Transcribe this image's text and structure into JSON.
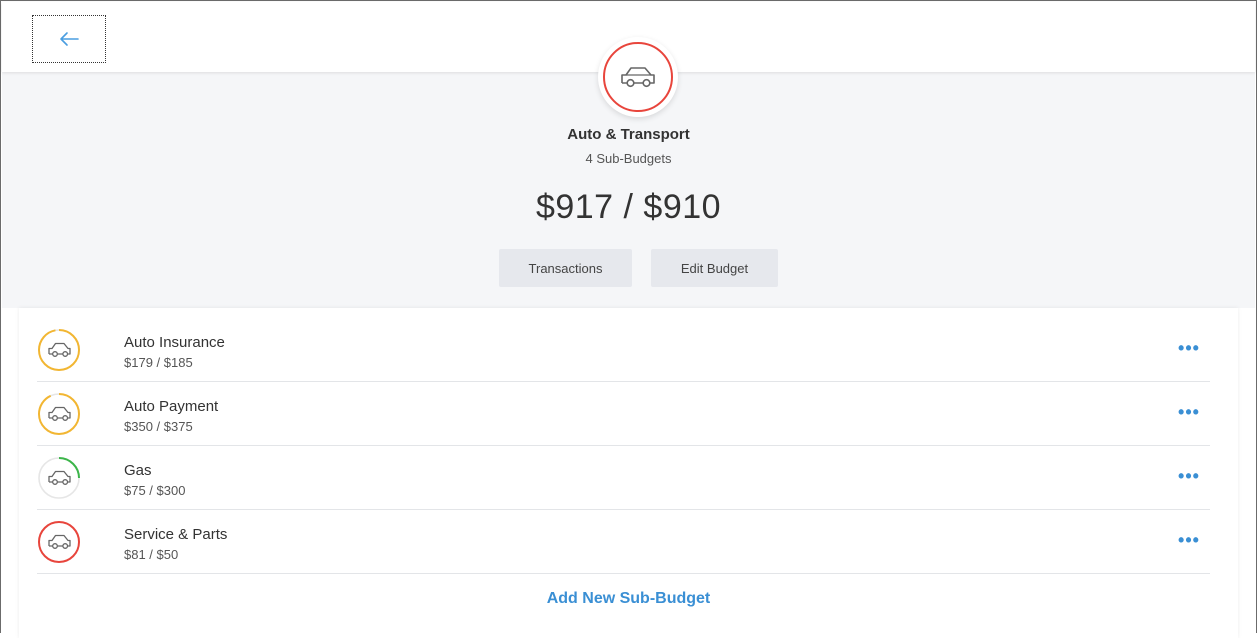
{
  "category": {
    "title": "Auto & Transport",
    "subtitle": "4 Sub-Budgets",
    "amount": "$917 / $910",
    "icon": "car-icon",
    "ring_color": "#e8453c"
  },
  "buttons": {
    "transactions": "Transactions",
    "edit_budget": "Edit Budget"
  },
  "sub_budgets": [
    {
      "name": "Auto Insurance",
      "amount": "$179 / $185",
      "status_color": "#f2b632",
      "progress": 0.97
    },
    {
      "name": "Auto Payment",
      "amount": "$350 / $375",
      "status_color": "#f2b632",
      "progress": 0.93
    },
    {
      "name": "Gas",
      "amount": "$75 / $300",
      "status_color": "#3cb54a",
      "progress": 0.25
    },
    {
      "name": "Service & Parts",
      "amount": "$81 / $50",
      "status_color": "#e8453c",
      "progress": 1.0
    }
  ],
  "more_label": "•••",
  "add_link": "Add New Sub-Budget",
  "colors": {
    "accent": "#3a8fd4",
    "header_bg": "#f5f6f8"
  }
}
